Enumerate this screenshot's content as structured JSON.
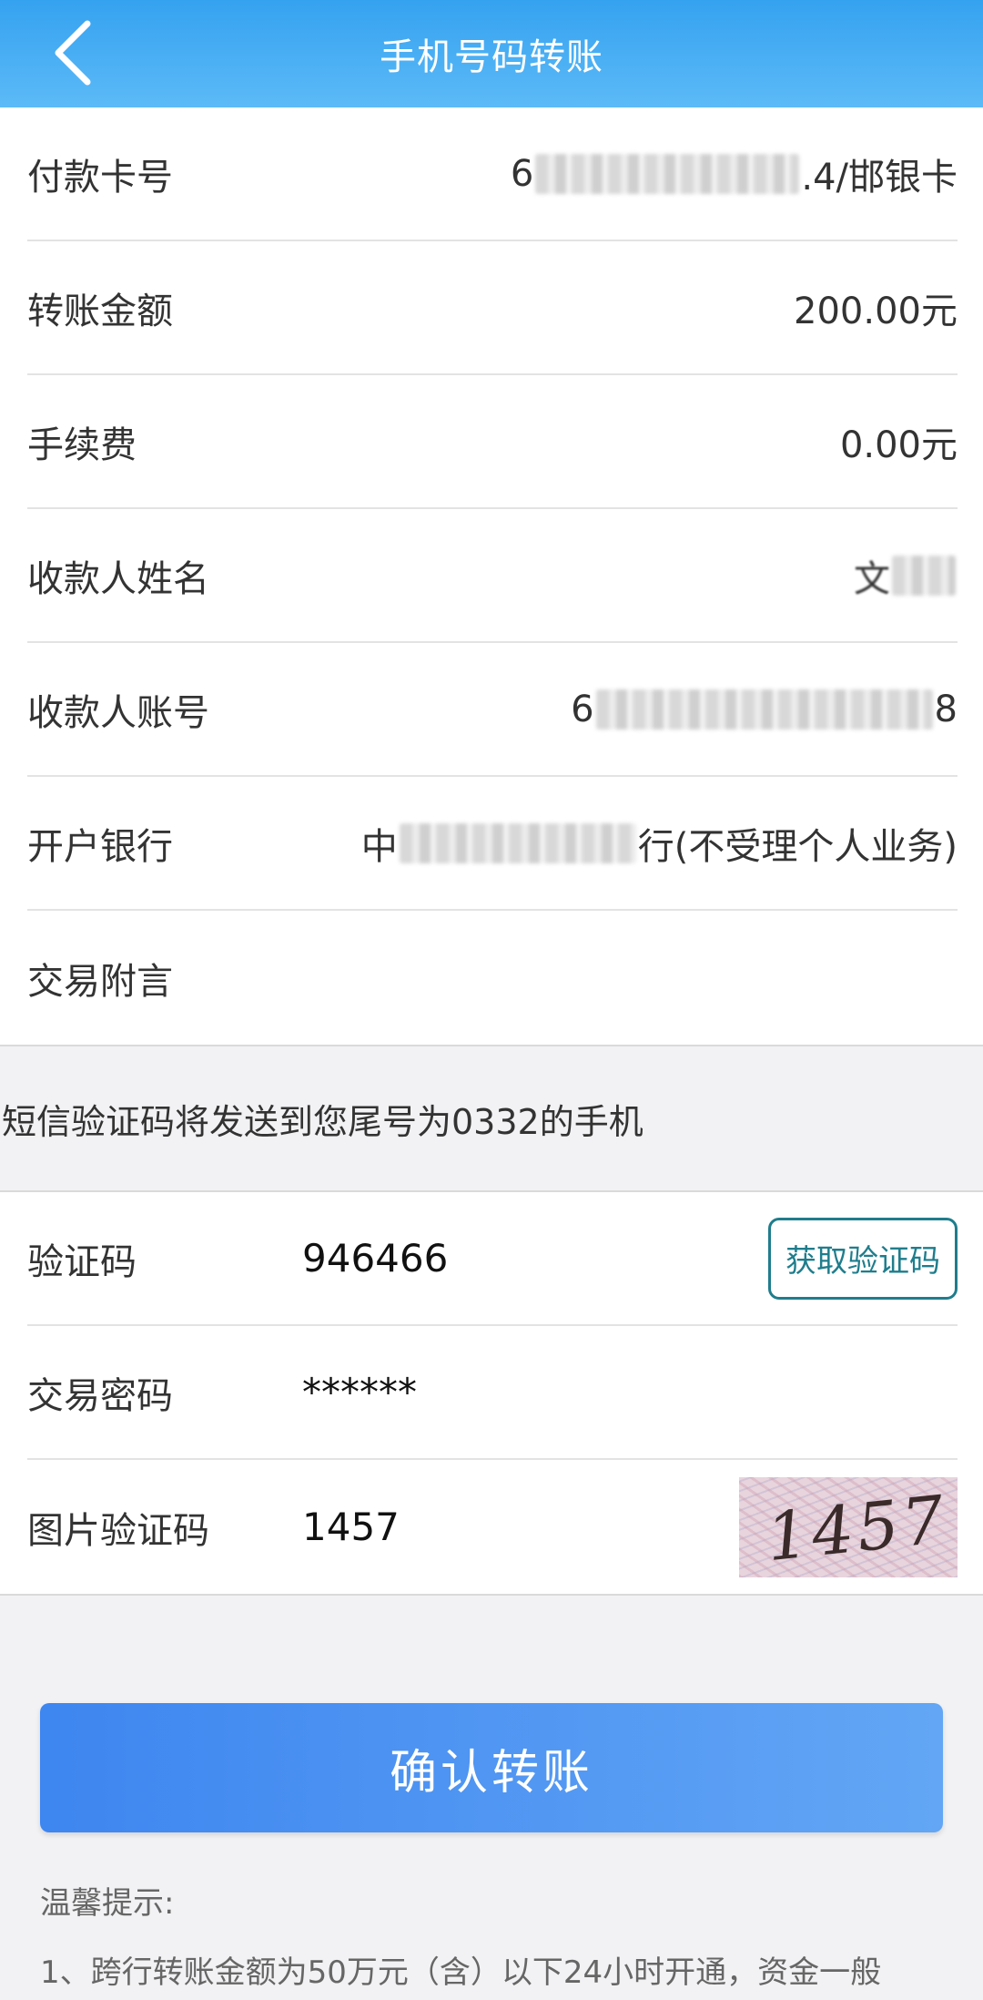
{
  "header": {
    "title": "手机号码转账"
  },
  "details": {
    "payment_card": {
      "label": "付款卡号",
      "prefix": "6",
      "suffix": ".4/邯银卡"
    },
    "amount": {
      "label": "转账金额",
      "value": "200.00元"
    },
    "fee": {
      "label": "手续费",
      "value": "0.00元"
    },
    "payee_name": {
      "label": "收款人姓名",
      "prefix": "文"
    },
    "payee_account": {
      "label": "收款人账号",
      "prefix": "6",
      "suffix": "8"
    },
    "bank": {
      "label": "开户银行",
      "prefix": "中",
      "suffix": "行(不受理个人业务)"
    },
    "remark": {
      "label": "交易附言",
      "value": ""
    }
  },
  "sms_notice": "短信验证码将发送到您尾号为0332的手机",
  "verify": {
    "sms_code": {
      "label": "验证码",
      "value": "946466",
      "button": "获取验证码"
    },
    "password": {
      "label": "交易密码",
      "value": "******"
    },
    "image_code": {
      "label": "图片验证码",
      "value": "1457",
      "captcha_text": "1457"
    }
  },
  "confirm_button": "确认转账",
  "tips": {
    "title": "温馨提示:",
    "lines": [
      "1、跨行转账金额为50万元（含）以下24小时开通，资金一般"
    ]
  },
  "colors": {
    "header": "#35a2f0",
    "button": "#3e86f0",
    "outline": "#1f7d8c"
  }
}
